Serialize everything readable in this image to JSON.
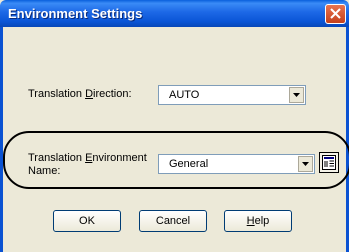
{
  "window": {
    "title": "Environment Settings"
  },
  "direction": {
    "label_pre": "Translation ",
    "label_key": "D",
    "label_post": "irection:",
    "value": "AUTO"
  },
  "environment": {
    "label_line1_pre": "Translation ",
    "label_line1_key": "E",
    "label_line1_post": "nvironment",
    "label_line2": "Name:",
    "value": "General"
  },
  "buttons": {
    "ok": "OK",
    "cancel": "Cancel",
    "help_key": "H",
    "help_rest": "elp"
  },
  "icons": {
    "close": "close-icon",
    "dropdown": "chevron-down-icon",
    "environment_settings": "settings-dialog-icon"
  }
}
